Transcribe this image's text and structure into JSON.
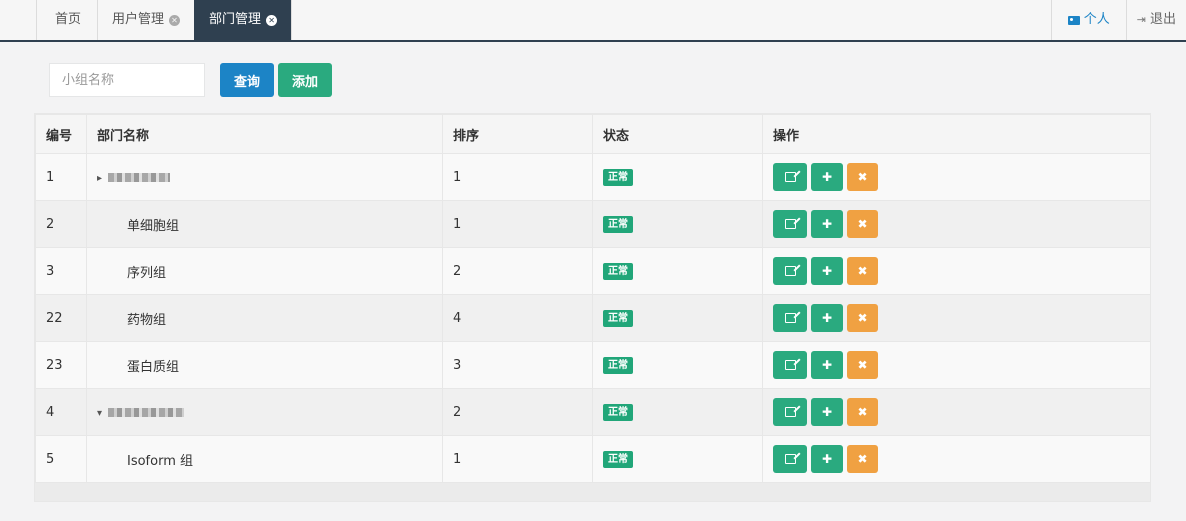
{
  "tabs": [
    {
      "label": "首页",
      "closable": false,
      "active": false
    },
    {
      "label": "用户管理",
      "closable": true,
      "active": false
    },
    {
      "label": "部门管理",
      "closable": true,
      "active": true
    }
  ],
  "header": {
    "profile_label": "个人",
    "logout_label": "退出"
  },
  "toolbar": {
    "search_placeholder": "小组名称",
    "search_value": "",
    "query_label": "查询",
    "add_label": "添加"
  },
  "table": {
    "columns": [
      "编号",
      "部门名称",
      "排序",
      "状态",
      "操作"
    ],
    "rows": [
      {
        "id": "1",
        "name": "",
        "level": 0,
        "redacted": true,
        "expand": "collapsed",
        "sort": "1",
        "status": "正常"
      },
      {
        "id": "2",
        "name": "单细胞组",
        "level": 1,
        "redacted": false,
        "sort": "1",
        "status": "正常"
      },
      {
        "id": "3",
        "name": "序列组",
        "level": 1,
        "redacted": false,
        "sort": "2",
        "status": "正常"
      },
      {
        "id": "22",
        "name": "药物组",
        "level": 1,
        "redacted": false,
        "sort": "4",
        "status": "正常"
      },
      {
        "id": "23",
        "name": "蛋白质组",
        "level": 1,
        "redacted": false,
        "sort": "3",
        "status": "正常"
      },
      {
        "id": "4",
        "name": "",
        "level": 0,
        "redacted": true,
        "expand": "expanded",
        "sort": "2",
        "status": "正常"
      },
      {
        "id": "5",
        "name": "Isoform 组",
        "level": 1,
        "redacted": false,
        "sort": "1",
        "status": "正常"
      }
    ]
  },
  "icons": {
    "profile": "id-card-icon",
    "logout": "sign-out-icon",
    "tab_close": "close-circle-icon",
    "edit": "edit-icon",
    "add_child": "plus-icon",
    "delete": "close-icon"
  },
  "colors": {
    "active_tab": "#2f4050",
    "primary": "#1c84c6",
    "success": "#2aaa7f",
    "warning": "#f0a142"
  }
}
